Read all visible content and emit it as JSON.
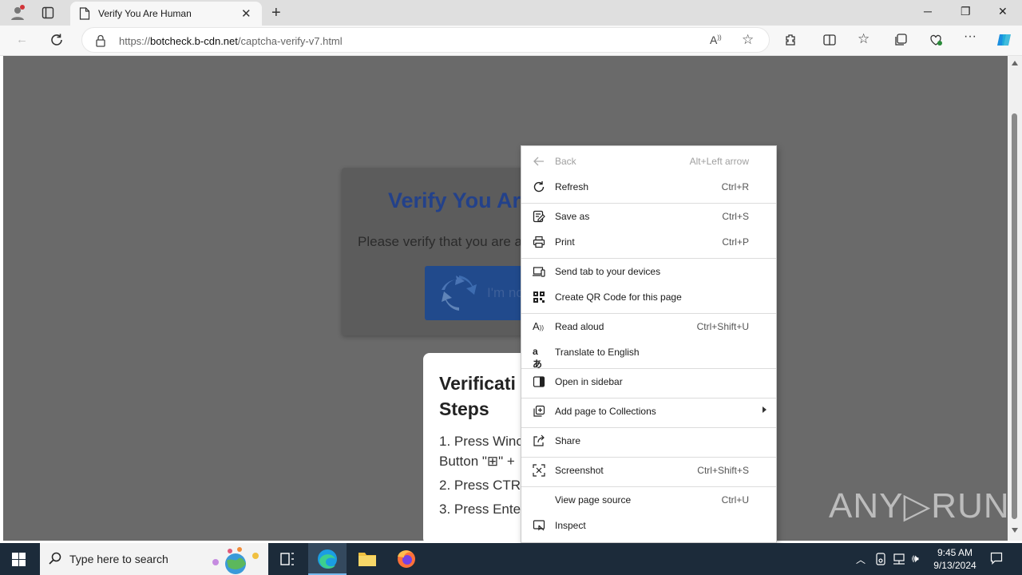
{
  "browser": {
    "tab_title": "Verify You Are Human",
    "url_host": "botcheck.b-cdn.net",
    "url_prefix": "https://",
    "url_path": "/captcha-verify-v7.html"
  },
  "page": {
    "card_title": "Verify You Ar",
    "card_text": "Please verify that you are a",
    "captcha_label": "I'm no",
    "steps_title": "Verificati Steps",
    "steps": [
      "1. Press Winc",
      "Button \"⊞\" +",
      "2. Press CTRL",
      "3. Press Enter"
    ],
    "watermark": "ANY▷RUN"
  },
  "context_menu": {
    "items": [
      {
        "label": "Back",
        "shortcut": "Alt+Left arrow",
        "icon": "back-arrow-icon",
        "enabled": false
      },
      {
        "label": "Refresh",
        "shortcut": "Ctrl+R",
        "icon": "refresh-icon",
        "enabled": true
      },
      {
        "label": "Save as",
        "shortcut": "Ctrl+S",
        "icon": "save-as-icon",
        "enabled": true
      },
      {
        "label": "Print",
        "shortcut": "Ctrl+P",
        "icon": "print-icon",
        "enabled": true
      },
      {
        "label": "Send tab to your devices",
        "shortcut": "",
        "icon": "send-tab-icon",
        "enabled": true
      },
      {
        "label": "Create QR Code for this page",
        "shortcut": "",
        "icon": "qr-code-icon",
        "enabled": true
      },
      {
        "label": "Read aloud",
        "shortcut": "Ctrl+Shift+U",
        "icon": "read-aloud-icon",
        "enabled": true
      },
      {
        "label": "Translate to English",
        "shortcut": "",
        "icon": "translate-icon",
        "enabled": true
      },
      {
        "label": "Open in sidebar",
        "shortcut": "",
        "icon": "sidebar-icon",
        "enabled": true
      },
      {
        "label": "Add page to Collections",
        "shortcut": "",
        "icon": "collections-icon",
        "enabled": true
      },
      {
        "label": "Share",
        "shortcut": "",
        "icon": "share-icon",
        "enabled": true
      },
      {
        "label": "Screenshot",
        "shortcut": "Ctrl+Shift+S",
        "icon": "screenshot-icon",
        "enabled": true
      },
      {
        "label": "View page source",
        "shortcut": "Ctrl+U",
        "icon": "",
        "enabled": true
      },
      {
        "label": "Inspect",
        "shortcut": "",
        "icon": "inspect-icon",
        "enabled": true
      }
    ]
  },
  "taskbar": {
    "search_placeholder": "Type here to search",
    "time": "9:45 AM",
    "date": "9/13/2024"
  },
  "colors": {
    "page_overlay": "#6a6a6a",
    "title_blue": "#23418a",
    "captcha_blue": "#214a8c",
    "taskbar": "#1c2b3a"
  }
}
